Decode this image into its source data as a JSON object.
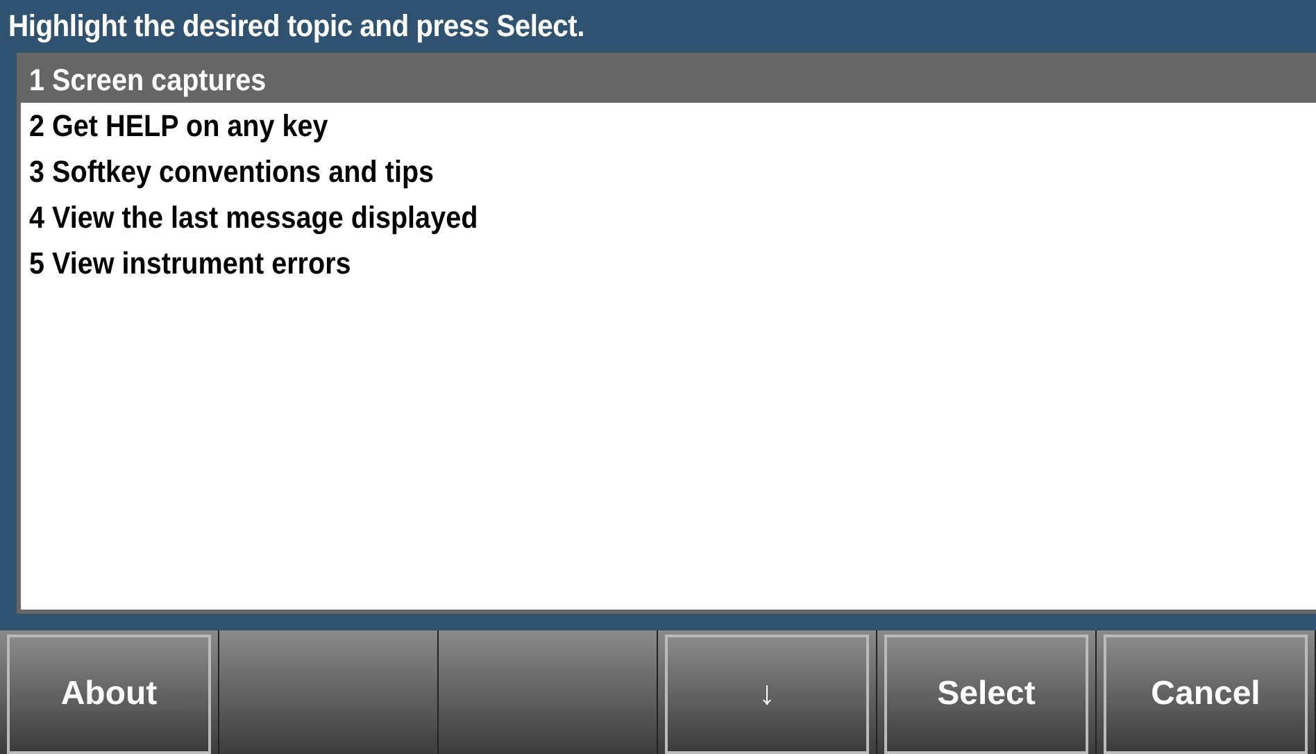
{
  "title": "Highlight the desired topic and press Select.",
  "topics": [
    {
      "label": "1 Screen captures",
      "selected": true
    },
    {
      "label": "2 Get HELP on any key",
      "selected": false
    },
    {
      "label": "3 Softkey conventions and tips",
      "selected": false
    },
    {
      "label": "4 View the last message displayed",
      "selected": false
    },
    {
      "label": "5 View instrument errors",
      "selected": false
    }
  ],
  "softkeys": [
    {
      "kind": "key",
      "label": "About"
    },
    {
      "kind": "blank"
    },
    {
      "kind": "blank"
    },
    {
      "kind": "key",
      "label": "↓"
    },
    {
      "kind": "key",
      "label": "Select"
    },
    {
      "kind": "key",
      "label": "Cancel"
    }
  ]
}
